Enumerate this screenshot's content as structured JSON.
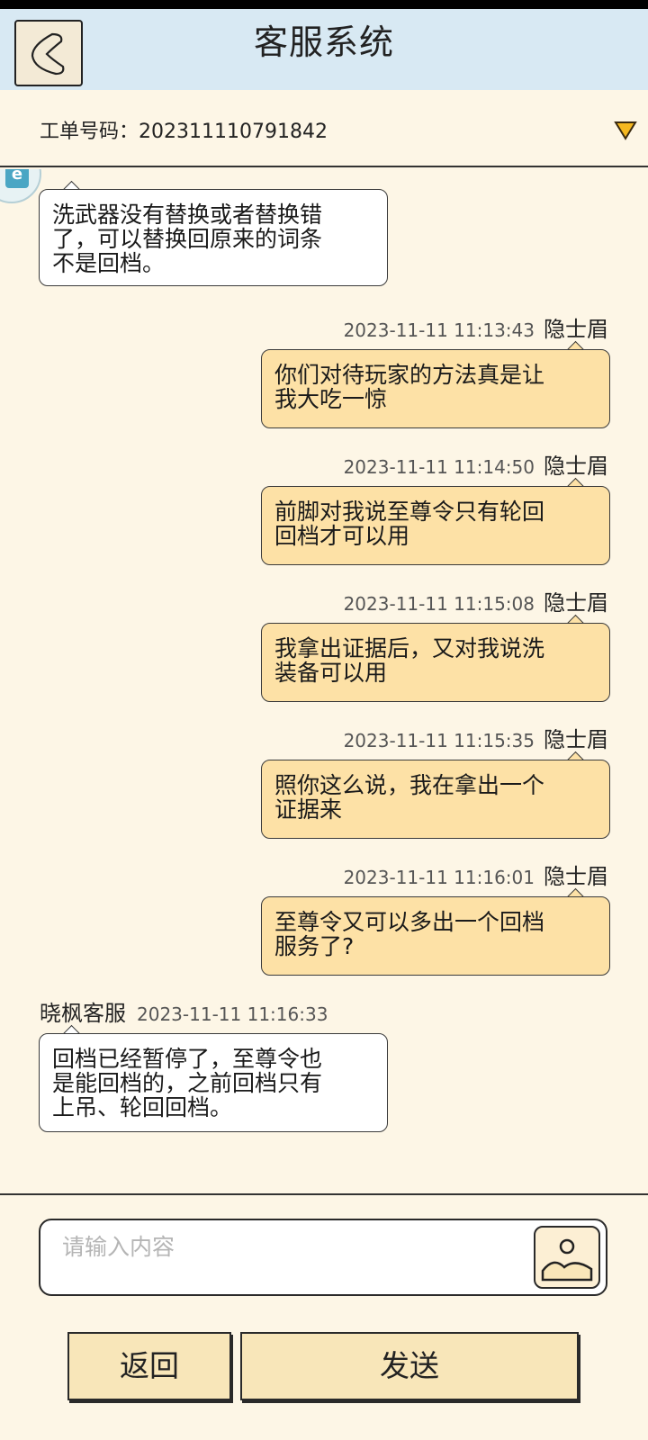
{
  "header": {
    "title": "客服系统",
    "back_icon": "back-arrow-icon"
  },
  "ticket": {
    "label": "工单号码：",
    "number": "202311110791842"
  },
  "messages": [
    {
      "id": 1,
      "sender": "agent",
      "text": "洗武器没有替换或者替换错\n了，可以替换回原来的词条\n不是回档。"
    },
    {
      "id": 2,
      "sender": "user",
      "name": "隐士眉",
      "time": "2023-11-11 11:13:43",
      "text": "你们对待玩家的方法真是让\n我大吃一惊"
    },
    {
      "id": 3,
      "sender": "user",
      "name": "隐士眉",
      "time": "2023-11-11 11:14:50",
      "text": "前脚对我说至尊令只有轮回\n回档才可以用"
    },
    {
      "id": 4,
      "sender": "user",
      "name": "隐士眉",
      "time": "2023-11-11 11:15:08",
      "text": "我拿出证据后，又对我说洗\n装备可以用"
    },
    {
      "id": 5,
      "sender": "user",
      "name": "隐士眉",
      "time": "2023-11-11 11:15:35",
      "text": "照你这么说，我在拿出一个\n证据来"
    },
    {
      "id": 6,
      "sender": "user",
      "name": "隐士眉",
      "time": "2023-11-11 11:16:01",
      "text": "至尊令又可以多出一个回档\n服务了?"
    },
    {
      "id": 7,
      "sender": "agent",
      "name": "晓枫客服",
      "time": "2023-11-11 11:16:33",
      "text": "回档已经暂停了，至尊令也\n是能回档的，之前回档只有\n上吊、轮回回档。"
    }
  ],
  "input": {
    "placeholder": "请输入内容",
    "value": ""
  },
  "buttons": {
    "back_label": "返回",
    "send_label": "发送"
  },
  "colors": {
    "header_bg": "#d8e9f3",
    "page_bg": "#fdf6e6",
    "user_bubble": "#fde1a6",
    "agent_bubble": "#ffffff",
    "accent": "#f5b820"
  }
}
